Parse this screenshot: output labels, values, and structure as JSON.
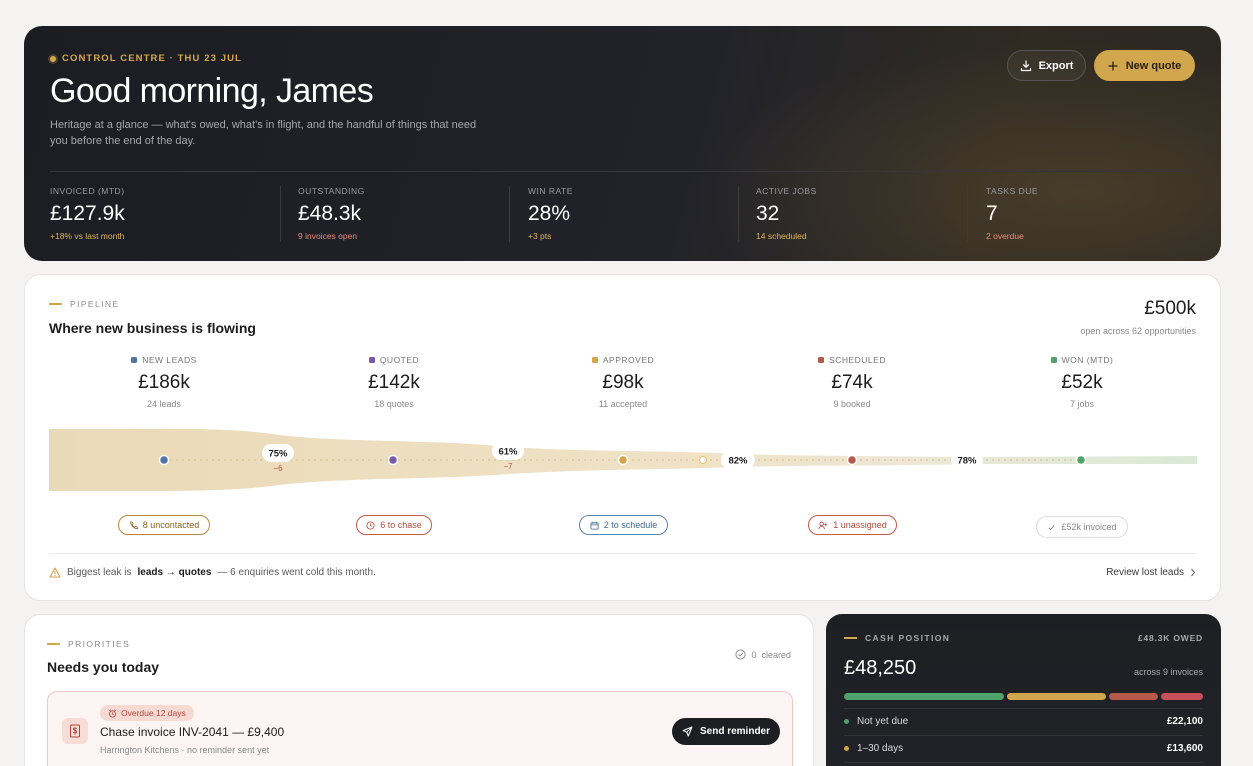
{
  "hero": {
    "eyebrow": "CONTROL CENTRE · THU 23 JUL",
    "greeting": "Good morning, James",
    "subtitle": "Heritage at a glance — what's owed, what's in flight, and the handful of things that need you before the end of the day.",
    "export_label": "Export",
    "new_quote_label": "New quote",
    "kpis": [
      {
        "label": "INVOICED (MTD)",
        "value": "£127.9k",
        "delta": "+18% vs last month",
        "delta_color": "#e0b45a"
      },
      {
        "label": "OUTSTANDING",
        "value": "£48.3k",
        "delta": "9 invoices open",
        "delta_color": "#e98a78"
      },
      {
        "label": "WIN RATE",
        "value": "28%",
        "delta": "+3 pts",
        "delta_color": "#e0b45a"
      },
      {
        "label": "ACTIVE JOBS",
        "value": "32",
        "delta": "14 scheduled",
        "delta_color": "#e0b45a"
      },
      {
        "label": "TASKS DUE",
        "value": "7",
        "delta": "2 overdue",
        "delta_color": "#e98a78"
      }
    ]
  },
  "pipeline": {
    "eyebrow": "PIPELINE",
    "title": "Where new business is flowing",
    "total": "£500k",
    "total_sub": "open across 62 opportunities",
    "stages": [
      {
        "label": "NEW LEADS",
        "value": "£186k",
        "sub": "24 leads",
        "color": "#4f74a8"
      },
      {
        "label": "QUOTED",
        "value": "£142k",
        "sub": "18 quotes",
        "color": "#7a5aa6"
      },
      {
        "label": "APPROVED",
        "value": "£98k",
        "sub": "11 accepted",
        "color": "#d2a64c"
      },
      {
        "label": "SCHEDULED",
        "value": "£74k",
        "sub": "9 booked",
        "color": "#b5594a"
      },
      {
        "label": "WON (MTD)",
        "value": "£52k",
        "sub": "7 jobs",
        "color": "#4ea36a"
      }
    ],
    "conversions": [
      {
        "rate": "75%",
        "drop": "−6"
      },
      {
        "rate": "61%",
        "drop": "−7"
      },
      {
        "rate": "82%",
        "drop": ""
      },
      {
        "rate": "78%",
        "drop": ""
      }
    ],
    "chips": [
      {
        "label": "8 uncontacted",
        "color": "#9a6a1f",
        "icon": "phone-icon"
      },
      {
        "label": "6 to chase",
        "color": "#b4473a",
        "icon": "clock-icon"
      },
      {
        "label": "2 to schedule",
        "color": "#3f6791",
        "icon": "calendar-icon"
      },
      {
        "label": "1 unassigned",
        "color": "#b4473a",
        "icon": "user-plus-icon"
      },
      {
        "label": "£52k invoiced",
        "color": "#8a8a8a",
        "icon": "check-icon"
      }
    ],
    "leak_prefix": "Biggest leak is",
    "leak_bold": "leads → quotes",
    "leak_suffix": "— 6 enquiries went cold this month.",
    "review_label": "Review lost leads"
  },
  "priorities": {
    "eyebrow": "PRIORITIES",
    "title": "Needs you today",
    "cleared_count": "0",
    "cleared_label": "cleared",
    "task": {
      "tag": "Overdue 12 days",
      "title": "Chase invoice INV-2041 — £9,400",
      "sub": "Harrington Kitchens · no reminder sent yet",
      "action": "Send reminder"
    }
  },
  "cash": {
    "eyebrow": "CASH POSITION",
    "owed": "£48.3K OWED",
    "amount": "£48,250",
    "sub": "across 9 invoices",
    "segments": [
      {
        "value": 22100,
        "color": "#4ea36a"
      },
      {
        "value": 13600,
        "color": "#d2a64c"
      },
      {
        "value": 6800,
        "color": "#b5594a"
      },
      {
        "value": 5750,
        "color": "#c9505a"
      }
    ],
    "rows": [
      {
        "label": "Not yet due",
        "value": "£22,100",
        "color": "#4ea36a"
      },
      {
        "label": "1–30 days",
        "value": "£13,600",
        "color": "#d2a64c"
      }
    ]
  }
}
